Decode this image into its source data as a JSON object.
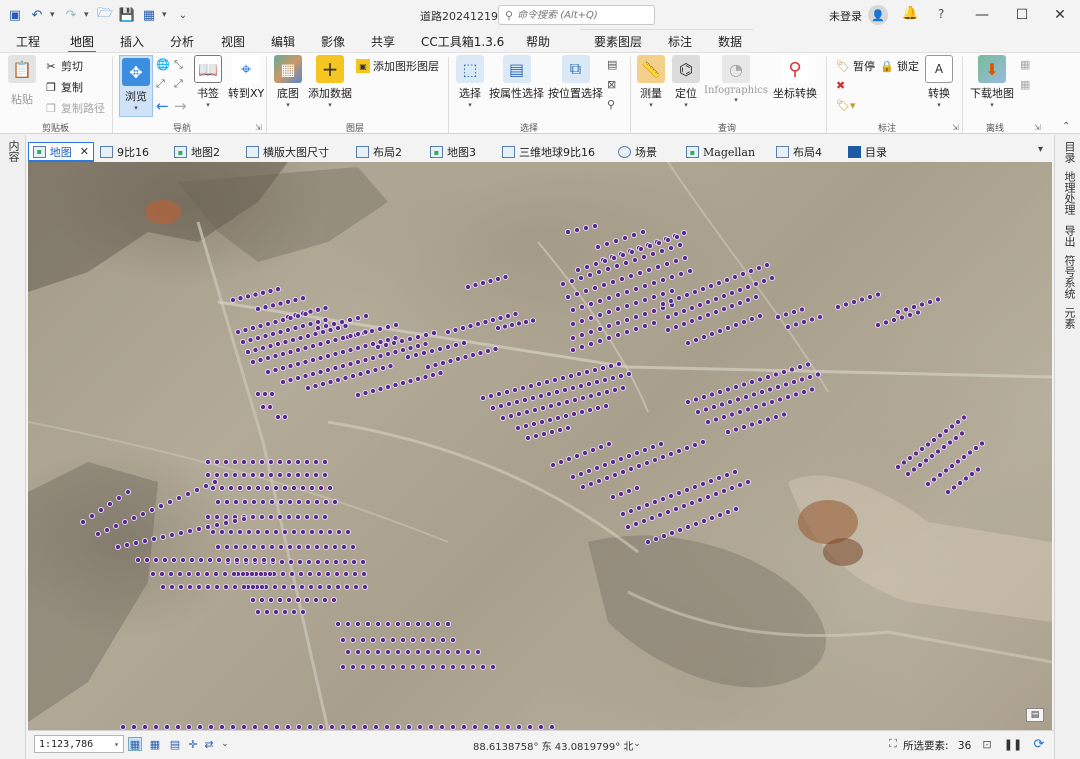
{
  "window": {
    "title": "道路20241219",
    "search_placeholder": "命令搜索 (Alt+Q)",
    "signin": "未登录"
  },
  "ribbon_tabs": [
    {
      "label": "工程"
    },
    {
      "label": "地图"
    },
    {
      "label": "插入"
    },
    {
      "label": "分析"
    },
    {
      "label": "视图"
    },
    {
      "label": "编辑"
    },
    {
      "label": "影像"
    },
    {
      "label": "共享"
    },
    {
      "label": "CC工具箱1.3.6"
    },
    {
      "label": "帮助"
    },
    {
      "label": "要素图层"
    },
    {
      "label": "标注"
    },
    {
      "label": "数据"
    }
  ],
  "ribbon": {
    "clipboard": {
      "paste": "粘贴",
      "cut": "剪切",
      "copy": "复制",
      "copy_path": "复制路径",
      "group": "剪贴板"
    },
    "navigate": {
      "explore": "浏览",
      "bookmarks": "书签",
      "goto_xy": "转到XY",
      "group": "导航"
    },
    "layer": {
      "basemap": "底图",
      "add_data": "添加数据",
      "add_graphics": "添加图形图层",
      "group": "图层"
    },
    "selection": {
      "select": "选择",
      "by_attr": "按属性选择",
      "by_loc": "按位置选择",
      "group": "选择"
    },
    "inquiry": {
      "measure": "测量",
      "locate": "定位",
      "infographics": "Infographics",
      "coord_convert": "坐标转换",
      "group": "查询"
    },
    "labeling": {
      "pause": "暂停",
      "lock": "锁定",
      "convert": "转换",
      "group": "标注"
    },
    "offline": {
      "download": "下载地图",
      "group": "离线"
    }
  },
  "left_panel": {
    "label": "内容"
  },
  "right_panels": [
    {
      "label": "目录"
    },
    {
      "label": "地理处理"
    },
    {
      "label": "导出"
    },
    {
      "label": "符号系统"
    },
    {
      "label": "元素"
    }
  ],
  "view_tabs": [
    {
      "label": "地图",
      "active": true
    },
    {
      "label": "9比16"
    },
    {
      "label": "地图2"
    },
    {
      "label": "横版大图尺寸"
    },
    {
      "label": "布局2"
    },
    {
      "label": "地图3"
    },
    {
      "label": "三维地球9比16"
    },
    {
      "label": "场景"
    },
    {
      "label": "Magellan"
    },
    {
      "label": "布局4"
    },
    {
      "label": "目录"
    }
  ],
  "status": {
    "scale": "1:123,786",
    "coords": "88.6138758° 东 43.0819799° 北",
    "selected_label": "所选要素:",
    "selected_count": "36"
  },
  "colors": {
    "accent": "#2a7ae2",
    "point_fill": "#5b2a8a",
    "point_stroke": "#e8e0ff"
  }
}
